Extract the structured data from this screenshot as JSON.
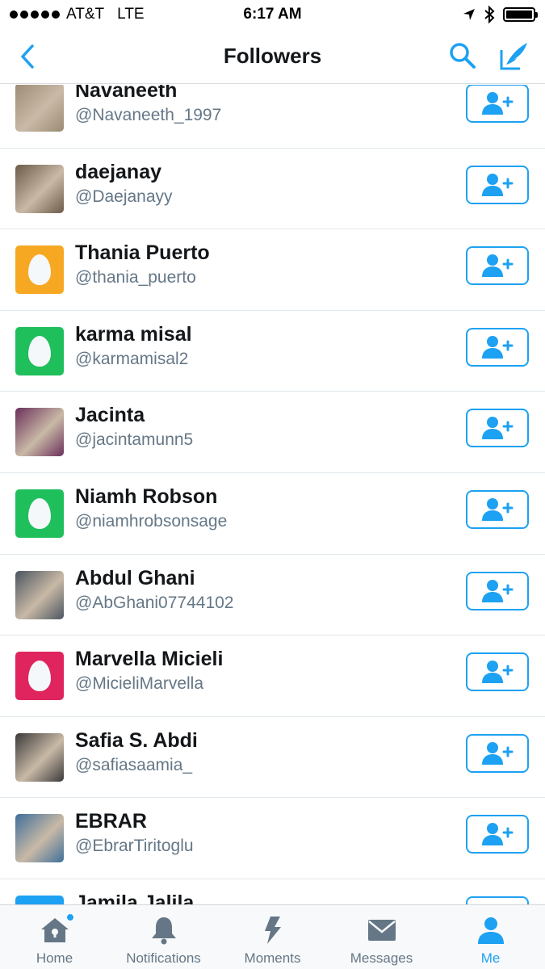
{
  "status": {
    "carrier": "AT&T",
    "network": "LTE",
    "time": "6:17 AM"
  },
  "nav": {
    "title": "Followers"
  },
  "colors": {
    "accent": "#1da1f2",
    "text": "#14171a",
    "secondary": "#657786"
  },
  "followers": [
    {
      "name": "Navaneeth",
      "handle": "@Navaneeth_1997",
      "avatar": "photo",
      "color": "#9c8a74"
    },
    {
      "name": "daejanay",
      "handle": "@Daejanayy",
      "avatar": "photo",
      "color": "#6d5a4a"
    },
    {
      "name": "Thania Puerto",
      "handle": "@thania_puerto",
      "avatar": "egg",
      "color": "#f7a823"
    },
    {
      "name": "karma misal",
      "handle": "@karmamisal2",
      "avatar": "egg",
      "color": "#1fbf5c"
    },
    {
      "name": "Jacinta",
      "handle": "@jacintamunn5",
      "avatar": "photo",
      "color": "#6a2f5a"
    },
    {
      "name": "Niamh Robson",
      "handle": "@niamhrobsonsage",
      "avatar": "egg",
      "color": "#1fbf5c"
    },
    {
      "name": "Abdul Ghani",
      "handle": "@AbGhani07744102",
      "avatar": "photo",
      "color": "#4b5560"
    },
    {
      "name": "Marvella Micieli",
      "handle": "@MicieliMarvella",
      "avatar": "egg",
      "color": "#e0245e"
    },
    {
      "name": "Safia S. Abdi",
      "handle": "@safiasaamia_",
      "avatar": "photo",
      "color": "#3a3a3a"
    },
    {
      "name": "EBRAR",
      "handle": "@EbrarTiritoglu",
      "avatar": "photo",
      "color": "#3f6f9a"
    },
    {
      "name": "Jamila Jalila",
      "handle": "",
      "avatar": "egg",
      "color": "#1da1f2"
    }
  ],
  "tabs": [
    {
      "label": "Home",
      "icon": "home-icon",
      "active": false
    },
    {
      "label": "Notifications",
      "icon": "bell-icon",
      "active": false
    },
    {
      "label": "Moments",
      "icon": "lightning-icon",
      "active": false
    },
    {
      "label": "Messages",
      "icon": "envelope-icon",
      "active": false
    },
    {
      "label": "Me",
      "icon": "person-icon",
      "active": true
    }
  ]
}
